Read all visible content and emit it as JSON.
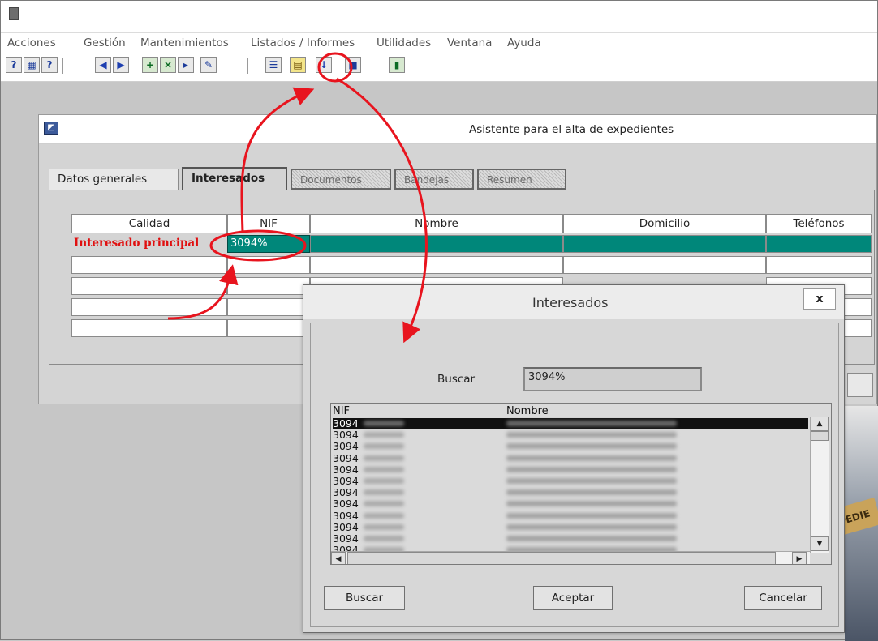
{
  "menu": [
    "Acciones",
    "Gestión",
    "Mantenimientos",
    "Listados / Informes",
    "Utilidades",
    "Ventana",
    "Ayuda"
  ],
  "toolbar": {
    "buttons": [
      "help-query-icon",
      "query-icon",
      "query-count-icon",
      "previous-record-icon",
      "next-record-icon",
      "insert-record-icon",
      "delete-record-icon",
      "duplicate-record-icon",
      "edit-icon",
      "list-values-icon",
      "notes-icon",
      "download-arrow-icon",
      "save-icon",
      "exit-door-icon"
    ]
  },
  "wizard": {
    "title": "Asistente para el alta de expedientes",
    "tabs": [
      {
        "label": "Datos generales",
        "state": "normal"
      },
      {
        "label": "Interesados",
        "state": "active"
      },
      {
        "label": "Documentos",
        "state": "disabled"
      },
      {
        "label": "Bandejas",
        "state": "disabled"
      },
      {
        "label": "Resumen",
        "state": "disabled"
      }
    ],
    "grid": {
      "headers": [
        "Calidad",
        "NIF",
        "Nombre",
        "Domicilio",
        "Teléfonos"
      ],
      "row1": {
        "calidad": "Interesado principal",
        "nif": "3094%"
      }
    }
  },
  "dialog": {
    "title": "Interesados",
    "close_label": "x",
    "search_label": "Buscar",
    "search_value": "3094%",
    "list_headers": {
      "nif": "NIF",
      "nombre": "Nombre"
    },
    "rows": [
      "3094",
      "3094",
      "3094",
      "3094",
      "3094",
      "3094",
      "3094",
      "3094",
      "3094",
      "3094",
      "3094",
      "3094",
      "3094"
    ],
    "buttons": {
      "buscar": "Buscar",
      "aceptar": "Aceptar",
      "cancelar": "Cancelar"
    }
  },
  "background_label": "PEDIE",
  "colors": {
    "annotation": "#e8141e",
    "selection": "#00877a",
    "required": "#e01010"
  }
}
